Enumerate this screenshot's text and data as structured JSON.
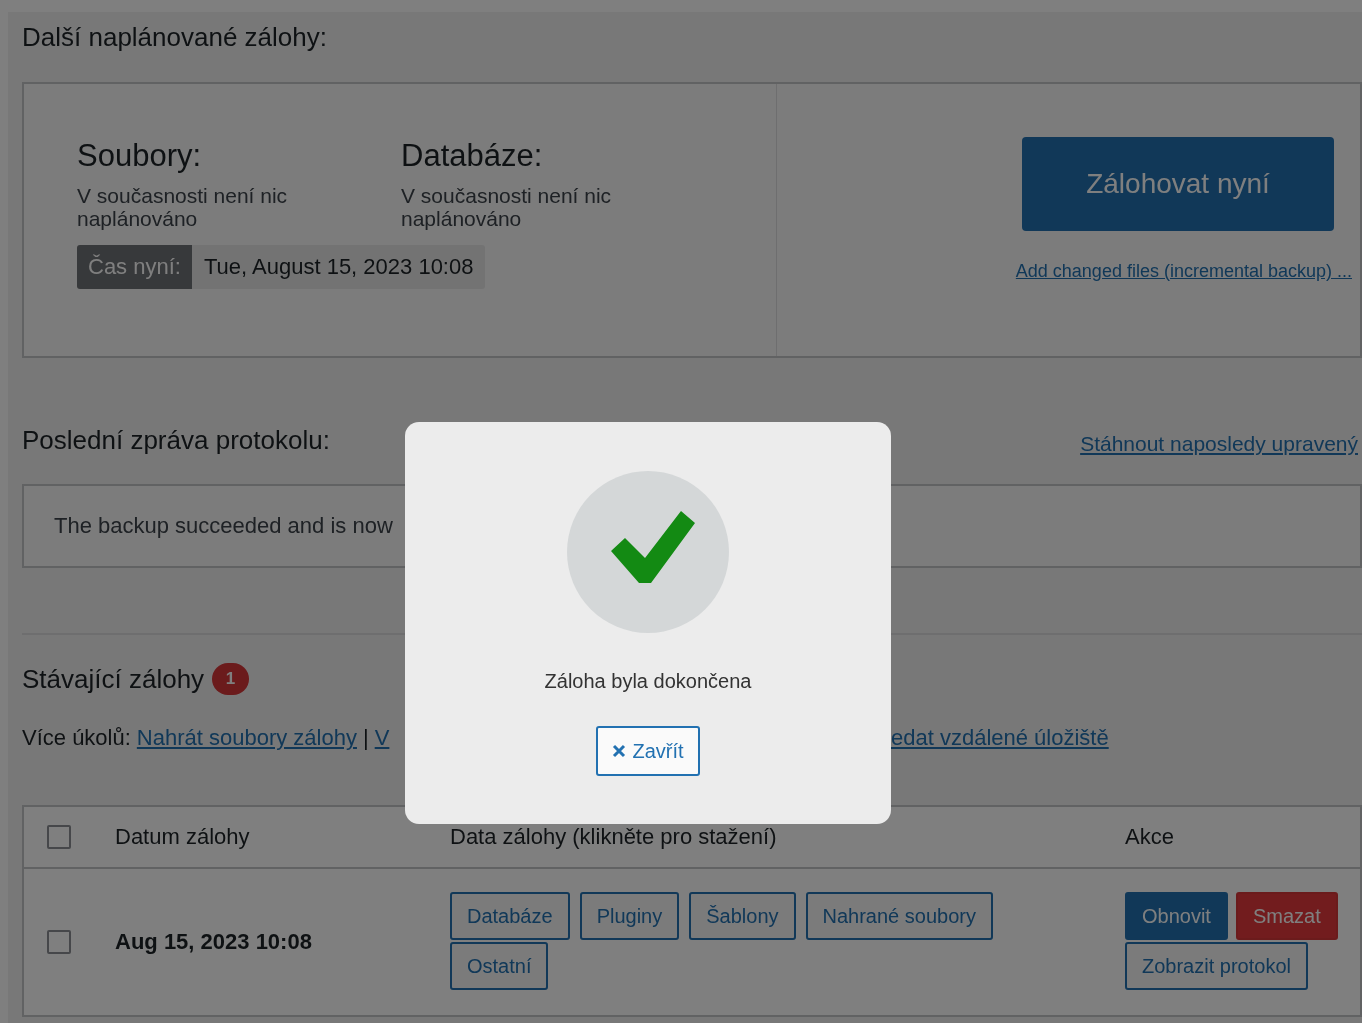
{
  "scheduled": {
    "heading": "Další naplánované zálohy:",
    "files": {
      "label": "Soubory:",
      "status": "V současnosti není nic naplánováno"
    },
    "database": {
      "label": "Databáze:",
      "status": "V současnosti není nic naplánováno"
    },
    "time": {
      "label": "Čas nyní:",
      "value": "Tue, August 15, 2023 10:08"
    },
    "backup_button": "Zálohovat nyní",
    "incremental_link": "Add changed files (incremental backup) ..."
  },
  "log": {
    "heading": "Poslední zpráva protokolu:",
    "download_link": "Stáhnout naposledy upravený",
    "message": "The backup succeeded and is now"
  },
  "existing": {
    "heading": "Stávající zálohy",
    "count": "1",
    "more_tasks_label": "Více úkolů:",
    "tasks_left": [
      {
        "kind": "link",
        "text": "Nahrát soubory zálohy"
      },
      {
        "kind": "separator",
        "text": "|"
      },
      {
        "kind": "link",
        "text": "V"
      }
    ],
    "tasks_right": [
      {
        "kind": "link",
        "text": "edat vzdálené úložiště"
      }
    ]
  },
  "table": {
    "select_all": {
      "checked": false
    },
    "columns": [
      "Datum zálohy",
      "Data zálohy (klikněte pro stažení)",
      "Akce"
    ],
    "rows": [
      {
        "checked": false,
        "date": "Aug 15, 2023 10:08",
        "data_buttons": [
          "Databáze",
          "Pluginy",
          "Šablony",
          "Nahrané soubory",
          "Ostatní"
        ],
        "actions": [
          {
            "label": "Obnovit",
            "kind": "primary"
          },
          {
            "label": "Smazat",
            "kind": "danger"
          },
          {
            "label": "Zobrazit protokol",
            "kind": "secondary"
          }
        ]
      }
    ]
  },
  "modal": {
    "message": "Záloha byla dokončena",
    "close_button": "Zavřít"
  }
}
